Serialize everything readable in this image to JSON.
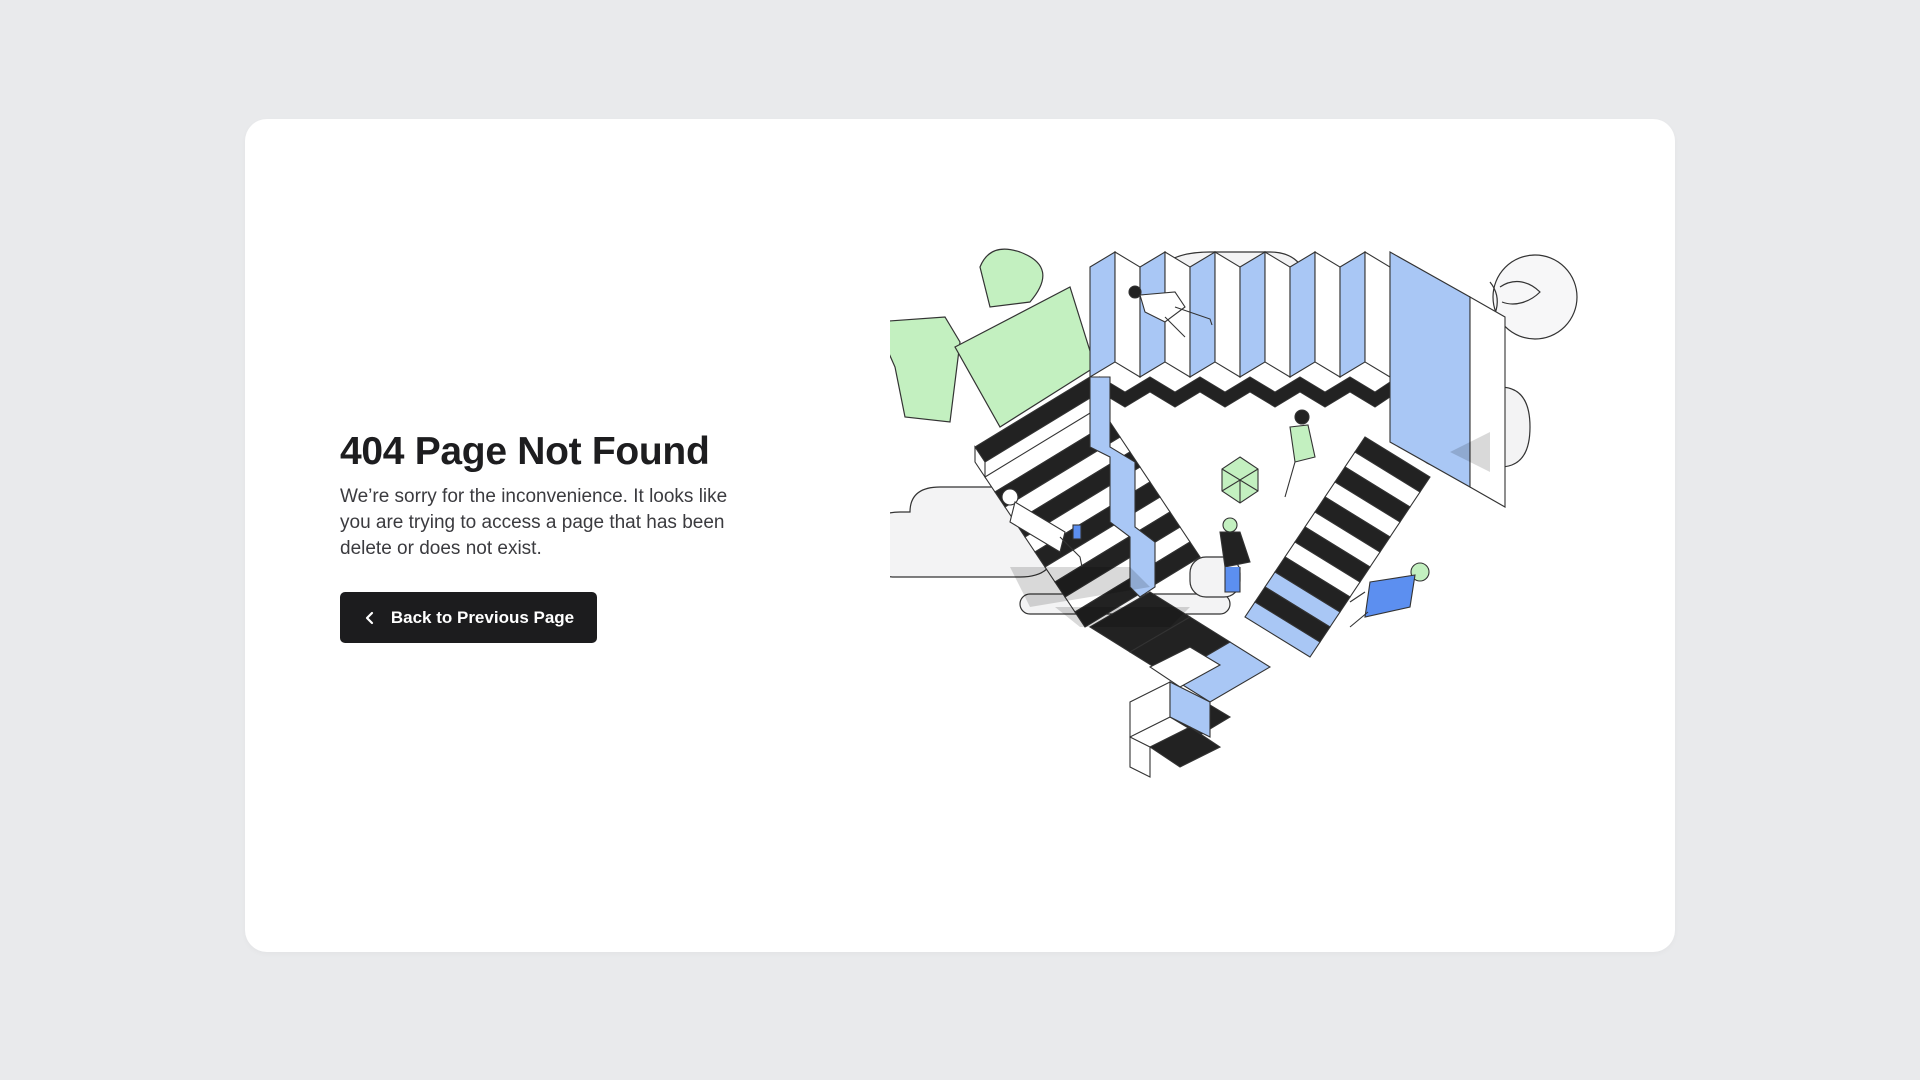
{
  "page": {
    "title": "404 Page Not Found",
    "message": "We’re sorry for the inconvenience. It looks like you are trying to access a page that has been delete or does not exist.",
    "back_button": {
      "label": "Back to Previous Page",
      "icon": "chevron-left-icon"
    },
    "illustration": {
      "name": "impossible-staircase-illustration"
    }
  },
  "colors": {
    "background": "#e9eaec",
    "card": "#ffffff",
    "button": "#1c1c1e",
    "accent_blue": "#a9c7f5",
    "accent_green": "#c3f0c0",
    "dark": "#222222"
  }
}
